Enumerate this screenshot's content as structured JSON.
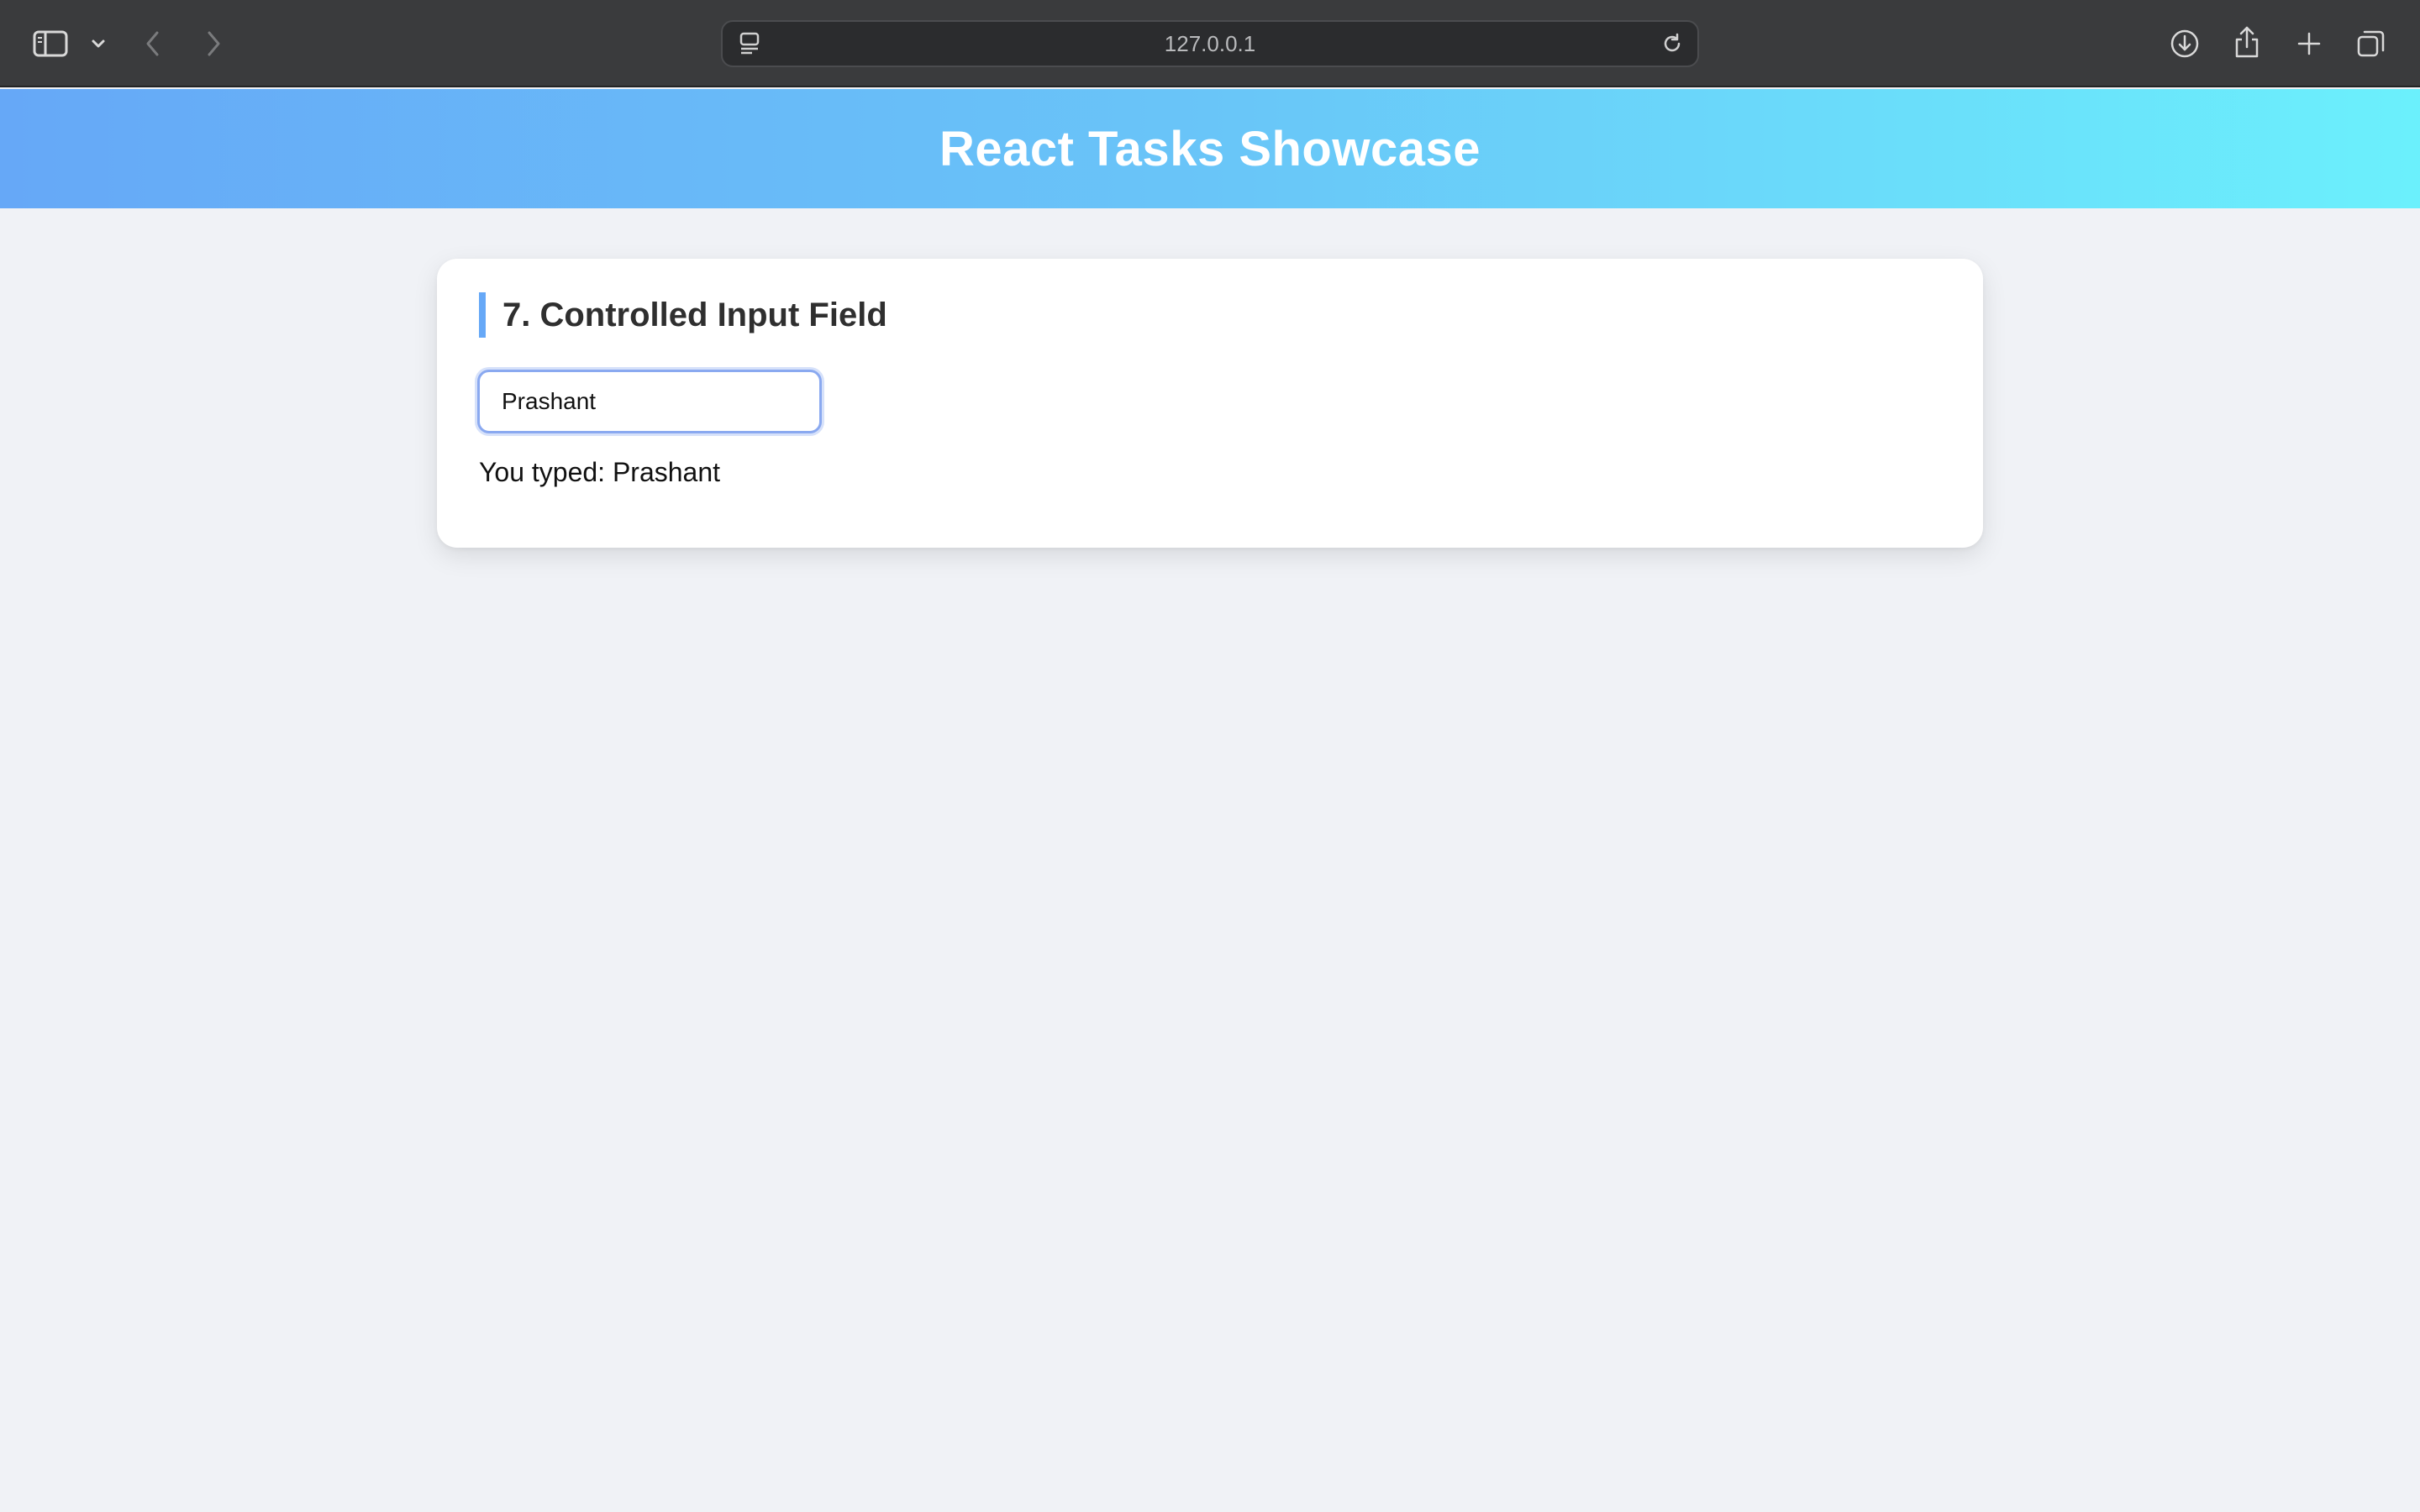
{
  "browser": {
    "address": "127.0.0.1",
    "icons": {
      "sidebar": "sidebar-icon",
      "chevron": "chevron-down-icon",
      "back": "back-arrow-icon",
      "forward": "forward-arrow-icon",
      "page_menu": "page-menu-icon",
      "reload": "reload-icon",
      "download": "download-icon",
      "share": "share-icon",
      "new_tab": "plus-icon",
      "tabs": "tabs-overview-icon"
    }
  },
  "header": {
    "title": "React Tasks Showcase",
    "gradient_start": "#66a8f7",
    "gradient_end": "#6bf0fc"
  },
  "card": {
    "title": "7. Controlled Input Field",
    "input_value": "Prashant",
    "output_label": "You typed:",
    "output_value": "Prashant",
    "accent_color": "#66a8f7"
  }
}
